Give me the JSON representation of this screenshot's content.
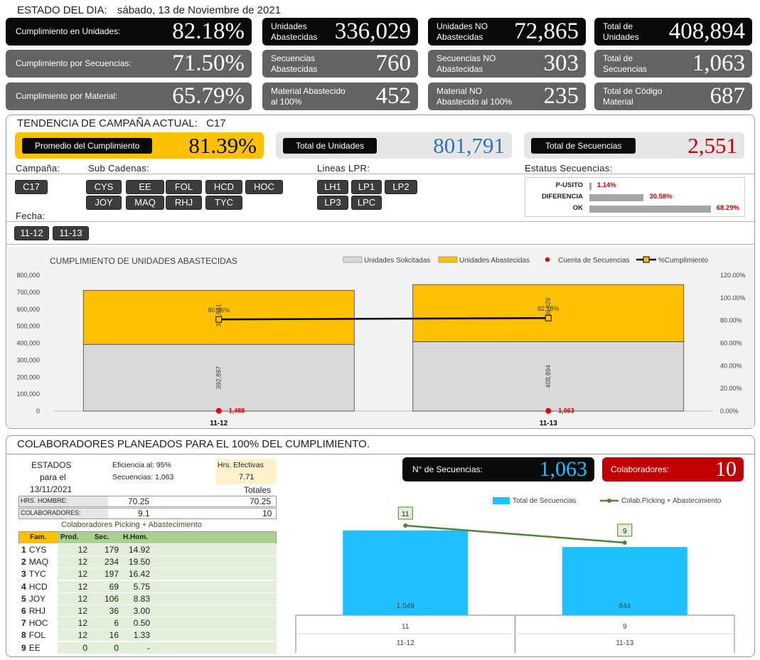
{
  "header": {
    "title": "ESTADO DEL DIA:",
    "date": "sábado, 13 de Noviembre de 2021"
  },
  "kpis": [
    {
      "label": "Cumplimiento en Unidades:",
      "value": "82.18%"
    },
    {
      "label": "Unidades\nAbastecidas",
      "value": "336,029"
    },
    {
      "label": "Unidades NO\nAbastecidas",
      "value": "72,865"
    },
    {
      "label": "Total de\nUnidades",
      "value": "408,894"
    },
    {
      "label": "Cumplimiento por Secuencias:",
      "value": "71.50%"
    },
    {
      "label": "Secuencias\nAbastecidas",
      "value": "760"
    },
    {
      "label": "Secuencias NO\nAbastecidas",
      "value": "303"
    },
    {
      "label": "Total de\nSecuencias",
      "value": "1,063"
    },
    {
      "label": "Cumplimiento por Material:",
      "value": "65.79%"
    },
    {
      "label": "Material Abastecido\nal 100%",
      "value": "452"
    },
    {
      "label": "Material NO\nAbastecido al 100%",
      "value": "235"
    },
    {
      "label": "Total de Código\nMaterial",
      "value": "687"
    }
  ],
  "trend": {
    "title": "TENDENCIA DE CAMPAÑA ACTUAL:",
    "campaign": "C17",
    "avg_label": "Promedio  del Cumplimiento",
    "avg_value": "81.39%",
    "units_label": "Total de Unidades",
    "units_value": "801,791",
    "seq_label": "Total de Secuencias",
    "seq_value": "2,551",
    "colors": {
      "avg_bg": "#ffc000",
      "units_val": "#2e75b6",
      "seq_val": "#c00000"
    }
  },
  "filters": {
    "campana_label": "Campaña:",
    "campana": [
      "C17"
    ],
    "subcadenas_label": "Sub Cadenas:",
    "subcadenas": [
      "CYS",
      "EE",
      "FOL",
      "HCD",
      "HOC",
      "JOY",
      "MAQ",
      "RHJ",
      "TYC"
    ],
    "lineas_label": "Lineas LPR:",
    "lineas": [
      "LH1",
      "LP1",
      "LP2",
      "LP3",
      "LPC"
    ],
    "estatus_label": "Estatus Secuencias:",
    "fecha_label": "Fecha:",
    "fechas": [
      "11-12",
      "11-13"
    ]
  },
  "estatus_chart": {
    "labels": [
      "P-USITO",
      "DIFERENCIA",
      "OK"
    ],
    "values": [
      1.14,
      30.58,
      68.29
    ],
    "value_labels": [
      "1.14%",
      "30.58%",
      "68.29%"
    ]
  },
  "chart_data": [
    {
      "type": "bar",
      "title": "CUMPLIMIENTO DE UNIDADES ABASTECIDAS",
      "categories": [
        "11-12",
        "11-13"
      ],
      "series": [
        {
          "name": "Unidades Solicitadas",
          "values": [
            392897,
            408894
          ],
          "labels": [
            "392,897",
            "408,894"
          ],
          "color": "#d9d9d9"
        },
        {
          "name": "Unidades Abastecidas",
          "values": [
            318000,
            336029
          ],
          "labels": [
            "318,651",
            "336,029"
          ],
          "color": "#ffc000"
        },
        {
          "name": "Cuenta de Secuencias",
          "values": [
            1488,
            1063
          ],
          "labels": [
            "1,488",
            "1,063"
          ],
          "color": "#e00000"
        },
        {
          "name": "%Cumplimiento",
          "values": [
            80.96,
            82.18
          ],
          "labels": [
            "80.96%",
            "82.18%"
          ],
          "color": "#000000"
        }
      ],
      "stacked": true,
      "ylim": [
        0,
        800000
      ],
      "yticks": [
        "0",
        "100,000",
        "200,000",
        "300,000",
        "400,000",
        "500,000",
        "600,000",
        "700,000",
        "800,000"
      ],
      "y2lim": [
        0,
        120
      ],
      "y2ticks": [
        "0.00%",
        "20.00%",
        "40.00%",
        "60.00%",
        "80.00%",
        "100.00%",
        "120.00%"
      ],
      "legend": "top-right"
    },
    {
      "type": "bar",
      "categories": [
        "11-12",
        "11-13"
      ],
      "x_secondary": [
        "11",
        "9"
      ],
      "series": [
        {
          "name": "Total de Secuencias",
          "values": [
            1049,
            844
          ],
          "labels": [
            "1,049",
            "844"
          ],
          "color": "#1ec0ff"
        },
        {
          "name": "Colab.Picking + Abastecimiento",
          "values": [
            11,
            9
          ],
          "labels": [
            "11",
            "9"
          ],
          "color": "#538135"
        }
      ],
      "legend": "top"
    }
  ],
  "colab": {
    "title": "COLABORADORES PLANEADOS PARA EL 100% DEL CUMPLIMIENTO.",
    "estados_l1": "ESTADOS",
    "estados_l2": "para el",
    "estados_date": "13/11/2021",
    "eficiencia_label": "Eficiencia al:",
    "eficiencia_value": "95%",
    "secuencias_label": "Secuencias:",
    "secuencias_value": "1,063",
    "hrs_efectivas_label": "Hrs. Efectivas",
    "hrs_efectivas_value": "7.71",
    "totales_label": "Totales",
    "hrs_hombre_label": "HRS. HOMBRE:",
    "hrs_hombre_value": "70.25",
    "hrs_hombre_total": "70.25",
    "colaboradores_label": "COLABORADORES:",
    "colaboradores_value": "9.1",
    "colaboradores_total": "10",
    "table_title": "Colaboradores Picking + Abastecimiento",
    "columns": [
      "Fam.",
      "Prod.",
      "Sec.",
      "H.Hom."
    ],
    "rows": [
      {
        "n": "1",
        "fam": "CYS",
        "prod": "12",
        "sec": "179",
        "hh": "14.92"
      },
      {
        "n": "2",
        "fam": "MAQ",
        "prod": "12",
        "sec": "234",
        "hh": "19.50"
      },
      {
        "n": "3",
        "fam": "TYC",
        "prod": "12",
        "sec": "197",
        "hh": "16.42"
      },
      {
        "n": "4",
        "fam": "HCD",
        "prod": "12",
        "sec": "69",
        "hh": "5.75"
      },
      {
        "n": "5",
        "fam": "JOY",
        "prod": "12",
        "sec": "106",
        "hh": "8.83"
      },
      {
        "n": "6",
        "fam": "RHJ",
        "prod": "12",
        "sec": "36",
        "hh": "3.00"
      },
      {
        "n": "7",
        "fam": "HOC",
        "prod": "12",
        "sec": "6",
        "hh": "0.50"
      },
      {
        "n": "8",
        "fam": "FOL",
        "prod": "12",
        "sec": "16",
        "hh": "1.33"
      },
      {
        "n": "9",
        "fam": "EE",
        "prod": "0",
        "sec": "0",
        "hh": "-"
      }
    ],
    "nseq_label": "N° de Secuencias:",
    "nseq_value": "1,063",
    "colab_label": "Colaboradores:",
    "colab_value": "10",
    "colors": {
      "nseq_val": "#1ec0ff",
      "colab_bg": "#c00000",
      "table_header": "#ffc000",
      "table_header_rest": "#a9d08e"
    }
  }
}
